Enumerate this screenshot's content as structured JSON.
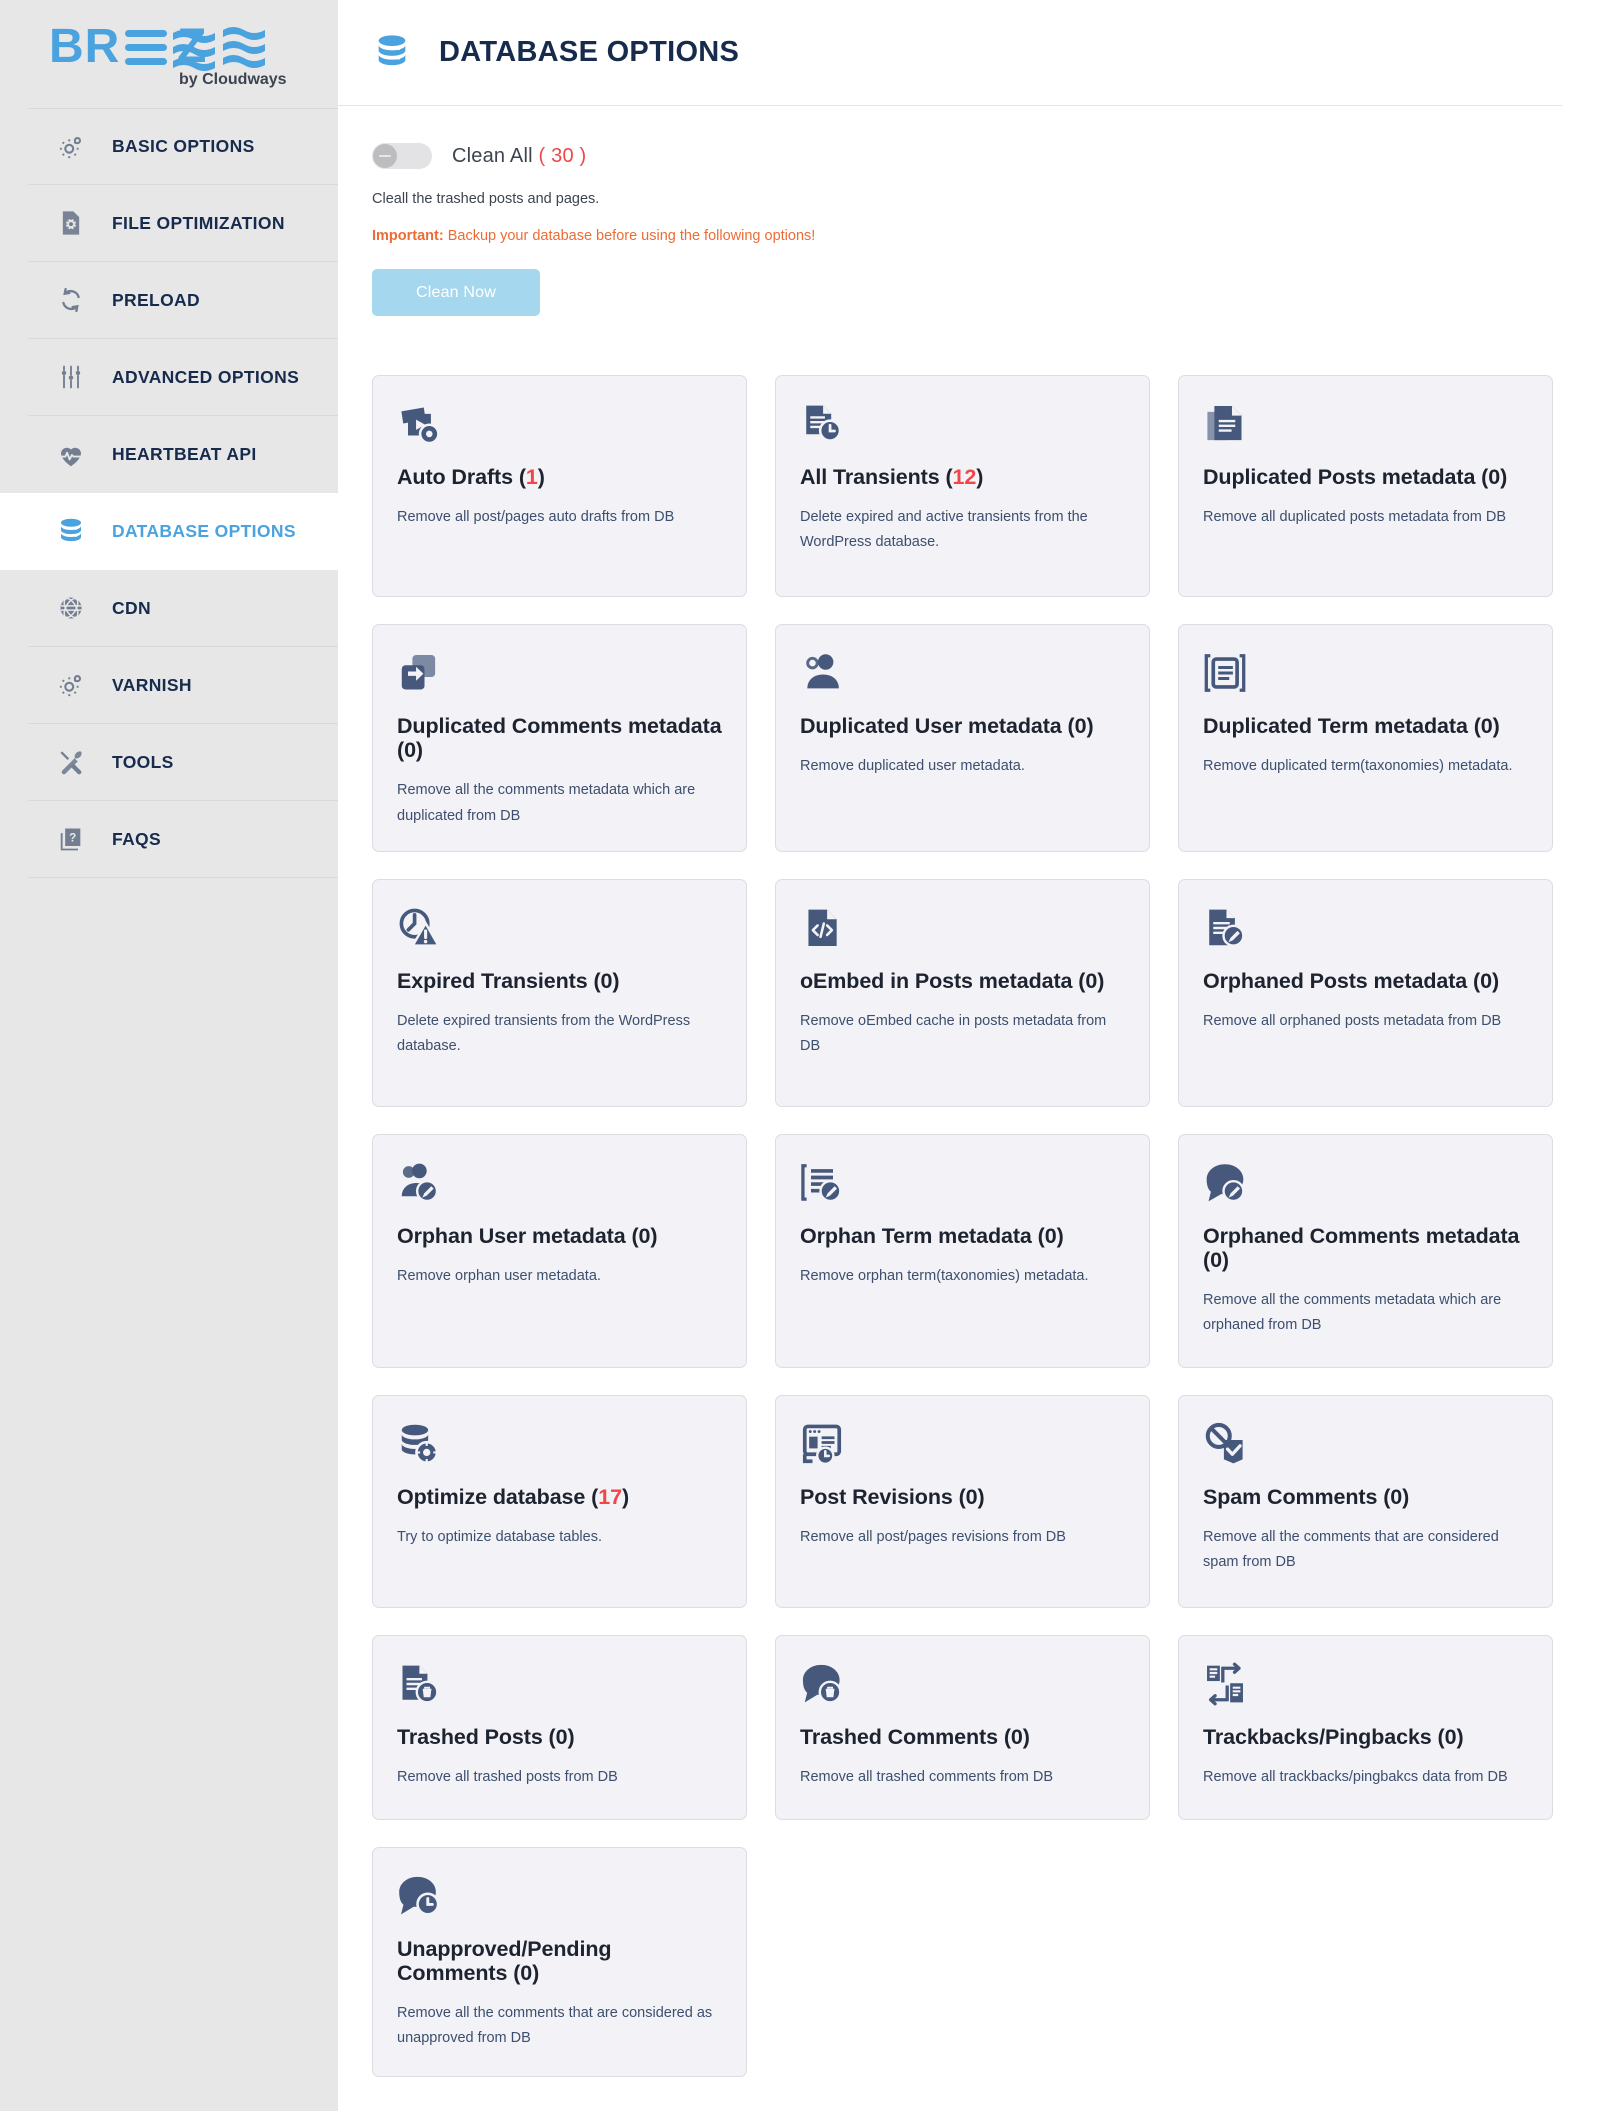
{
  "brand": {
    "name": "BREEZE",
    "tagline": "by Cloudways"
  },
  "sidebar": {
    "items": [
      {
        "label": "BASIC OPTIONS",
        "icon": "gear-icon",
        "active": false
      },
      {
        "label": "FILE OPTIMIZATION",
        "icon": "file-gear-icon",
        "active": false
      },
      {
        "label": "PRELOAD",
        "icon": "refresh-icon",
        "active": false
      },
      {
        "label": "ADVANCED OPTIONS",
        "icon": "sliders-icon",
        "active": false
      },
      {
        "label": "HEARTBEAT API",
        "icon": "heart-pulse-icon",
        "active": false
      },
      {
        "label": "DATABASE OPTIONS",
        "icon": "database-icon",
        "active": true
      },
      {
        "label": "CDN",
        "icon": "globe-icon",
        "active": false
      },
      {
        "label": "VARNISH",
        "icon": "gear-icon",
        "active": false
      },
      {
        "label": "TOOLS",
        "icon": "wrench-screwdriver-icon",
        "active": false
      },
      {
        "label": "FAQS",
        "icon": "question-box-icon",
        "active": false
      }
    ]
  },
  "header": {
    "title": "DATABASE OPTIONS",
    "icon": "database-icon"
  },
  "clean_all": {
    "toggle_state": "off",
    "label": "Clean All",
    "count": "( 30 )",
    "description": "Cleall the trashed posts and pages.",
    "important_prefix": "Important:",
    "important_text": " Backup your database before using the following options!",
    "button_label": "Clean Now"
  },
  "colors": {
    "accent": "#4aa3df",
    "count_red": "#f24646",
    "warning_orange": "#ed6c35",
    "icon_navy": "#46597c",
    "button_blue": "#a5d8ef",
    "sidebar_bg": "#e7e7e8",
    "card_bg": "#f2f2f7"
  },
  "cards": [
    {
      "icon": "auto-drafts-icon",
      "title": "Auto Drafts ",
      "count_open": "(",
      "count": "1",
      "count_close": ")",
      "count_is_red": true,
      "description": "Remove all post/pages auto drafts from DB"
    },
    {
      "icon": "transients-clock-icon",
      "title": "All Transients ",
      "count_open": "(",
      "count": "12",
      "count_close": ")",
      "count_is_red": true,
      "description": "Delete expired and active transients from the WordPress database."
    },
    {
      "icon": "duplicated-posts-icon",
      "title": "Duplicated Posts metadata ",
      "count_open": "(",
      "count": "0",
      "count_close": ")",
      "count_is_red": false,
      "description": "Remove all duplicated posts metadata from DB"
    },
    {
      "icon": "duplicated-comments-icon",
      "title": "Duplicated Comments metadata ",
      "count_open": "(",
      "count": "0",
      "count_close": ")",
      "count_is_red": false,
      "description": "Remove all the comments metadata which are duplicated from DB"
    },
    {
      "icon": "duplicated-user-icon",
      "title": "Duplicated User metadata ",
      "count_open": "(",
      "count": "0",
      "count_close": ")",
      "count_is_red": false,
      "description": "Remove duplicated user metadata."
    },
    {
      "icon": "duplicated-term-icon",
      "title": "Duplicated Term metadata ",
      "count_open": "(",
      "count": "0",
      "count_close": ")",
      "count_is_red": false,
      "description": "Remove duplicated term(taxonomies) metadata."
    },
    {
      "icon": "expired-transients-icon",
      "title": "Expired Transients ",
      "count_open": "(",
      "count": "0",
      "count_close": ")",
      "count_is_red": false,
      "description": "Delete expired transients from the WordPress database."
    },
    {
      "icon": "oembed-code-icon",
      "title": "oEmbed in Posts metadata ",
      "count_open": "(",
      "count": "0",
      "count_close": ")",
      "count_is_red": false,
      "description": "Remove oEmbed cache in posts metadata from DB"
    },
    {
      "icon": "orphaned-posts-icon",
      "title": "Orphaned Posts metadata ",
      "count_open": "(",
      "count": "0",
      "count_close": ")",
      "count_is_red": false,
      "description": "Remove all orphaned posts metadata from DB"
    },
    {
      "icon": "orphan-user-icon",
      "title": "Orphan User metadata ",
      "count_open": "(",
      "count": "0",
      "count_close": ")",
      "count_is_red": false,
      "description": "Remove orphan user metadata."
    },
    {
      "icon": "orphan-term-icon",
      "title": "Orphan Term metadata ",
      "count_open": "(",
      "count": "0",
      "count_close": ")",
      "count_is_red": false,
      "description": "Remove orphan term(taxonomies) metadata."
    },
    {
      "icon": "orphaned-comments-icon",
      "title": "Orphaned Comments metadata ",
      "count_open": "(",
      "count": "0",
      "count_close": ")",
      "count_is_red": false,
      "description": "Remove all the comments metadata which are orphaned from DB"
    },
    {
      "icon": "optimize-database-icon",
      "title": "Optimize database ",
      "count_open": "(",
      "count": "17",
      "count_close": ")",
      "count_is_red": true,
      "description": "Try to optimize database tables."
    },
    {
      "icon": "post-revisions-icon",
      "title": "Post Revisions ",
      "count_open": "(",
      "count": "0",
      "count_close": ")",
      "count_is_red": false,
      "description": "Remove all post/pages revisions from DB"
    },
    {
      "icon": "spam-comments-icon",
      "title": "Spam Comments ",
      "count_open": "(",
      "count": "0",
      "count_close": ")",
      "count_is_red": false,
      "description": "Remove all the comments that are considered spam from DB"
    },
    {
      "icon": "trashed-posts-icon",
      "title": "Trashed Posts ",
      "count_open": "(",
      "count": "0",
      "count_close": ")",
      "count_is_red": false,
      "description": "Remove all trashed posts from DB"
    },
    {
      "icon": "trashed-comments-icon",
      "title": "Trashed Comments ",
      "count_open": "(",
      "count": "0",
      "count_close": ")",
      "count_is_red": false,
      "description": "Remove all trashed comments from DB"
    },
    {
      "icon": "trackbacks-pingbacks-icon",
      "title": "Trackbacks/Pingbacks ",
      "count_open": "(",
      "count": "0",
      "count_close": ")",
      "count_is_red": false,
      "description": "Remove all trackbacks/pingbakcs data from DB"
    },
    {
      "icon": "unapproved-comments-icon",
      "title": "Unapproved/Pending Comments ",
      "count_open": "(",
      "count": "0",
      "count_close": ")",
      "count_is_red": false,
      "description": "Remove all the comments that are considered as unapproved from DB"
    }
  ]
}
